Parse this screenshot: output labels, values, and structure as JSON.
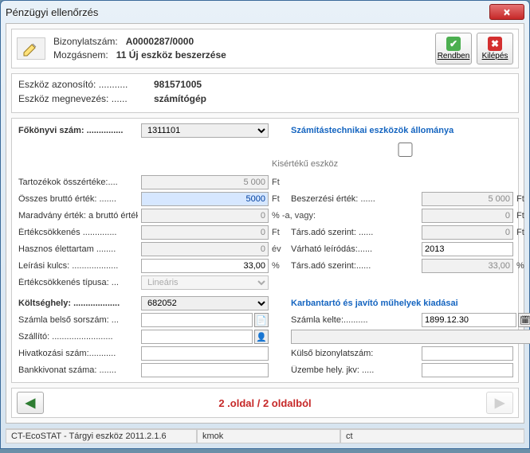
{
  "window": {
    "title": "Pénzügyi ellenőrzés"
  },
  "header": {
    "line1_label": "Bizonylatszám:",
    "line1_value": "A0000287/0000",
    "line2_label": "Mozgásnem:",
    "line2_value": "11  Új eszköz beszerzése",
    "btn_ok": "Rendben",
    "btn_exit": "Kilépés"
  },
  "ident": {
    "id_label": "Eszköz azonosító: ...........",
    "id_value": "981571005",
    "name_label": "Eszköz megnevezés: ......",
    "name_value": "számítógép"
  },
  "form": {
    "fokonyv_label": "Főkönyvi szám: ...............",
    "fokonyv_value": "1311101",
    "fokonyv_desc": "Számítástechnikai eszközök állománya",
    "kiserteku_label": "Kisértékű eszköz",
    "tart_label": "Tartozékok összértéke:....",
    "tart_value": "5 000",
    "ft": "Ft",
    "brutto_label": "Összes bruttó érték: .......",
    "brutto_value": "5000",
    "besz_label": "Beszerzési érték: ......",
    "besz_value": "5 000",
    "maradvany_label": "Maradvány érték: a bruttó érték .",
    "maradvany_pct": "0",
    "pct_vagy": "% -a, vagy:",
    "vagy_dots": "..........................",
    "vagy_value": "0",
    "ertekcsok_label": "Értékcsökkenés ..............",
    "ertekcsok_value": "0",
    "tars1_label": "Társ.adó szerint: ......",
    "tars1_value": "0",
    "hasznos_label": "Hasznos élettartam ........",
    "hasznos_value": "0",
    "ev": "év",
    "varhato_label": "Várható leíródás:......",
    "varhato_value": "2013",
    "leiras_label": "Leírási kulcs: ...................",
    "leiras_value": "33,00",
    "pct": "%",
    "tars2_label": "Társ.adó szerint:......",
    "tars2_value": "33,00",
    "tipus_label": "Értékcsökkenés típusa: ...",
    "tipus_value": "Lineáris",
    "kh_label": "Költséghely: ...................",
    "kh_value": "682052",
    "kh_desc": "Karbantartó és javító műhelyek kiadásai",
    "szbelso_label": "Számla belső sorszám: ...",
    "szbelso_value": "",
    "szkelte_label": "Számla kelte:..........",
    "szkelte_value": "1899.12.30",
    "szallito_label": "Szállító: .........................",
    "szallito_value": "",
    "hiv_label": "Hivatkozási szám:...........",
    "kulso_label": "Külső bizonylatszám:",
    "bank_label": "Bankkivonat száma: .......",
    "uzembe_label": "Üzembe hely. jkv: .....",
    "hiv_value": "",
    "kulso_value": "",
    "bank_value": "",
    "uzembe_value": ""
  },
  "pager": {
    "text": "2 .oldal / 2 oldalból"
  },
  "status": {
    "app": "CT-EcoSTAT - Tárgyi eszköz 2011.2.1.6",
    "user": "kmok",
    "other": "ct"
  }
}
